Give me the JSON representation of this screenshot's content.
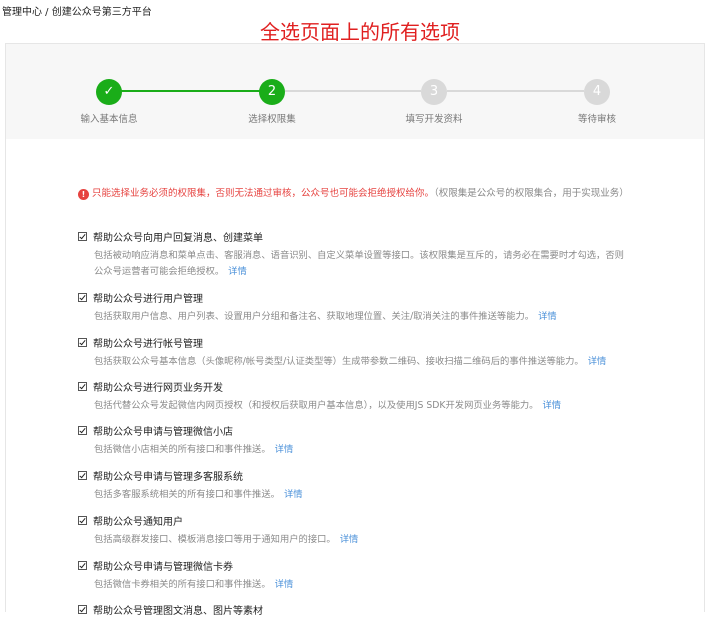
{
  "breadcrumb": "管理中心 / 创建公众号第三方平台",
  "annotation": "全选页面上的所有选项",
  "steps": [
    {
      "marker": "✓",
      "label": "输入基本信息",
      "state": "done"
    },
    {
      "marker": "2",
      "label": "选择权限集",
      "state": "current"
    },
    {
      "marker": "3",
      "label": "填写开发资料",
      "state": "pending"
    },
    {
      "marker": "4",
      "label": "等待审核",
      "state": "pending"
    }
  ],
  "notice": {
    "icon": "!",
    "warning": "只能选择业务必须的权限集，否则无法通过审核，公众号也可能会拒绝授权给你。",
    "note": "（权限集是公众号的权限集合，用于实现业务）"
  },
  "detail_label": "详情",
  "permissions": [
    {
      "title": "帮助公众号向用户回复消息、创建菜单",
      "checked": true,
      "desc": [
        "包括被动响应消息和菜单点击、客服消息、语音识别、自定义菜单设置等接口。该权限集是互斥的，请务必在需要时才勾选，否则",
        "公众号运营者可能会拒绝授权。"
      ]
    },
    {
      "title": "帮助公众号进行用户管理",
      "checked": true,
      "desc": [
        "包括获取用户信息、用户列表、设置用户分组和备注名、获取地理位置、关注/取消关注的事件推送等能力。"
      ]
    },
    {
      "title": "帮助公众号进行帐号管理",
      "checked": true,
      "desc": [
        "包括获取公众号基本信息（头像昵称/帐号类型/认证类型等）生成带参数二维码、接收扫描二维码后的事件推送等能力。"
      ]
    },
    {
      "title": "帮助公众号进行网页业务开发",
      "checked": true,
      "desc": [
        "包括代替公众号发起微信内网页授权（和授权后获取用户基本信息），以及使用JS SDK开发网页业务等能力。"
      ]
    },
    {
      "title": "帮助公众号申请与管理微信小店",
      "checked": true,
      "desc": [
        "包括微信小店相关的所有接口和事件推送。"
      ]
    },
    {
      "title": "帮助公众号申请与管理多客服系统",
      "checked": true,
      "desc": [
        "包括多客服系统相关的所有接口和事件推送。"
      ]
    },
    {
      "title": "帮助公众号通知用户",
      "checked": true,
      "desc": [
        "包括高级群发接口、模板消息接口等用于通知用户的接口。"
      ]
    },
    {
      "title": "帮助公众号申请与管理微信卡券",
      "checked": true,
      "desc": [
        "包括微信卡券相关的所有接口和事件推送。"
      ]
    },
    {
      "title": "帮助公众号管理图文消息、图片等素材",
      "checked": true,
      "desc": []
    }
  ]
}
